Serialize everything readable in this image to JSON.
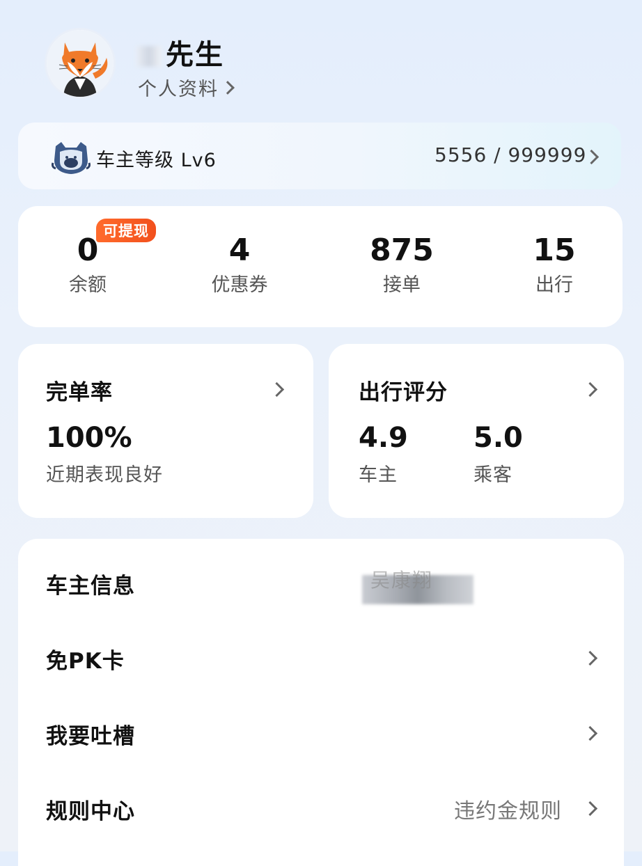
{
  "profile": {
    "name": "先生",
    "profile_link": "个人资料"
  },
  "level": {
    "label": "车主等级 Lv6",
    "progress": "5556 / 999999"
  },
  "stats": {
    "badge": "可提现",
    "items": [
      {
        "value": "0",
        "label": "余额"
      },
      {
        "value": "4",
        "label": "优惠券"
      },
      {
        "value": "875",
        "label": "接单"
      },
      {
        "value": "15",
        "label": "出行"
      }
    ]
  },
  "completion": {
    "title": "完单率",
    "value": "100%",
    "note": "近期表现良好"
  },
  "rating": {
    "title": "出行评分",
    "driver_value": "4.9",
    "driver_label": "车主",
    "passenger_value": "5.0",
    "passenger_label": "乘客"
  },
  "menu": {
    "driver_info": {
      "label": "车主信息",
      "value": "吴康翔"
    },
    "pk_card": {
      "label": "免PK卡"
    },
    "feedback": {
      "label": "我要吐槽"
    },
    "rules": {
      "label": "规则中心",
      "value": "违约金规则"
    }
  },
  "icons": {
    "avatar": "fox-avatar-icon",
    "level": "driver-level-badge-icon",
    "chevron": "chevron-right-icon"
  },
  "colors": {
    "badge": "#f2501d",
    "background": "#e4eefc",
    "card": "#ffffff"
  }
}
